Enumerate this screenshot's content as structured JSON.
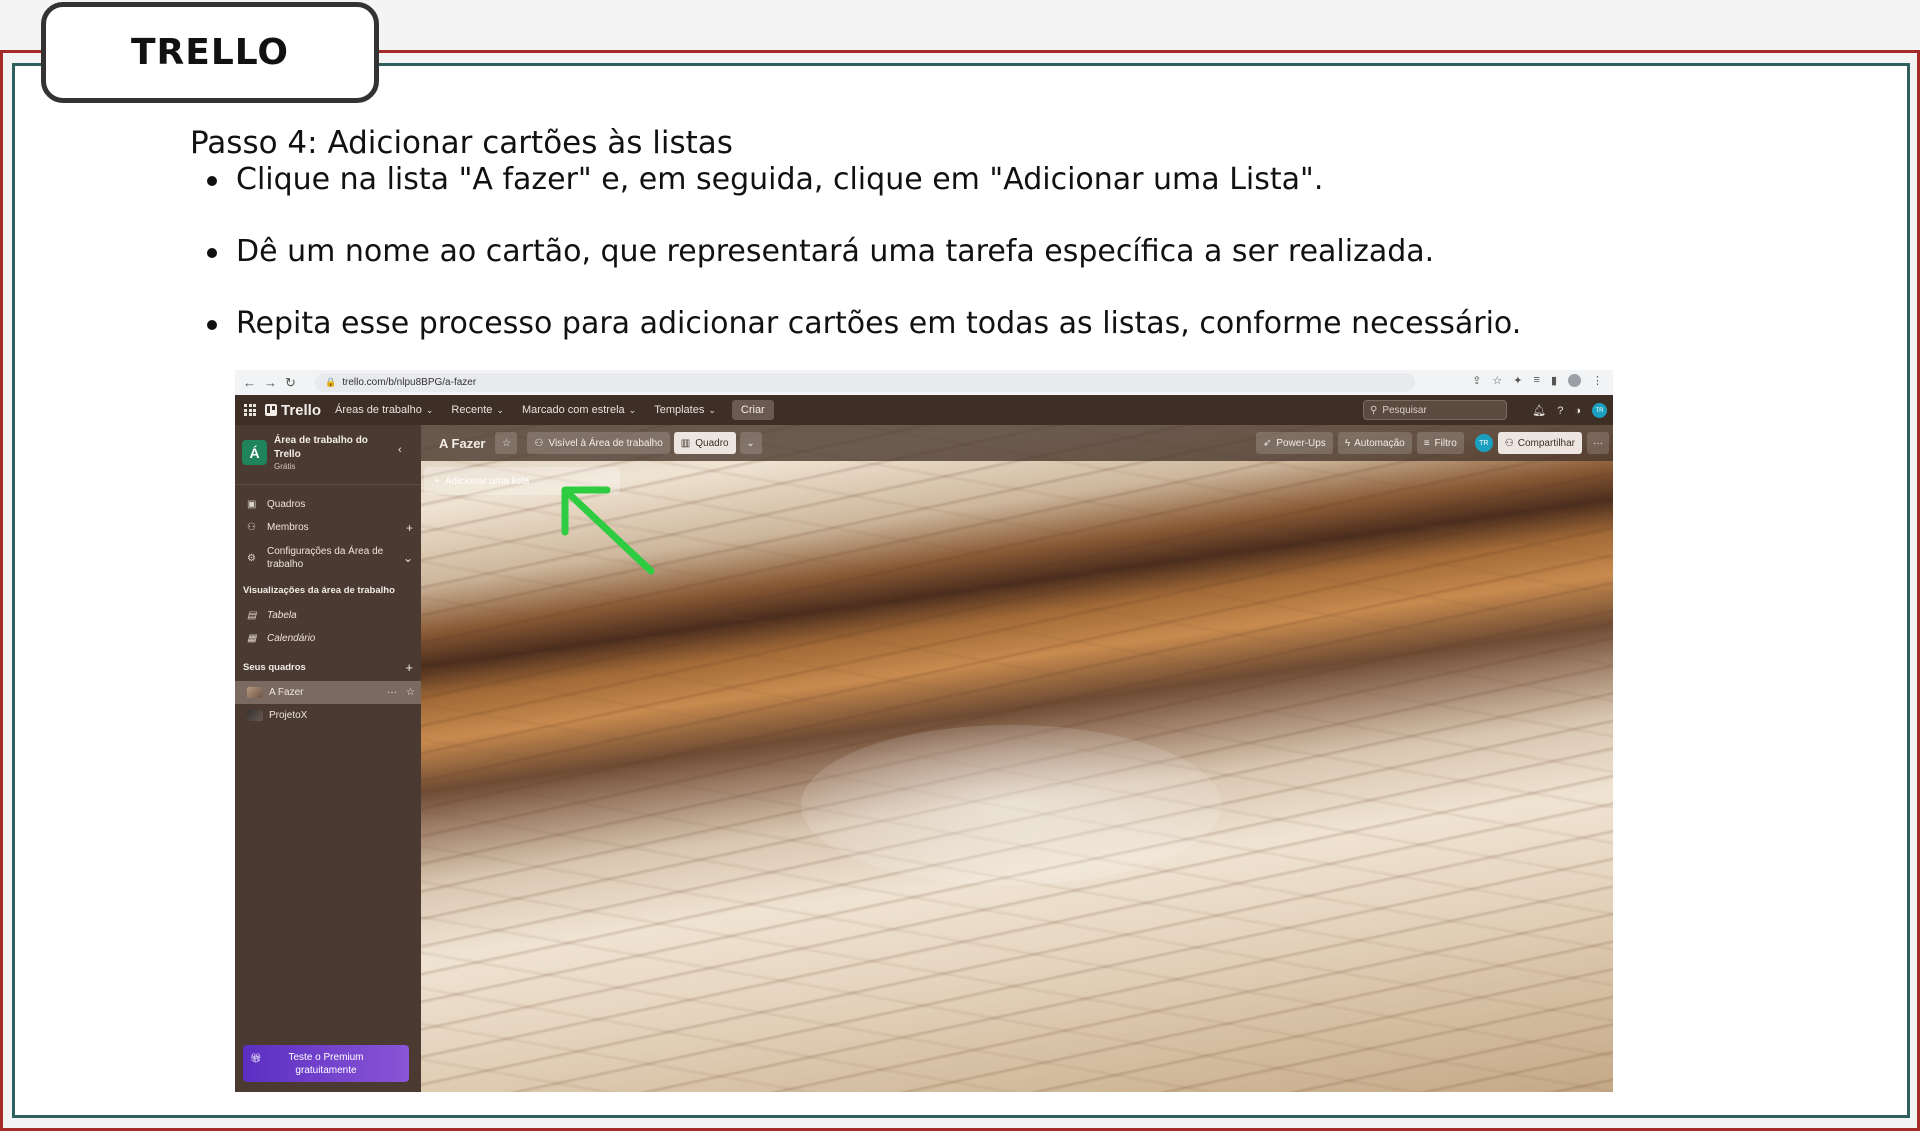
{
  "slide": {
    "tab_title": "TRELLO",
    "step_title": "Passo 4: Adicionar cartões às listas",
    "bullets": [
      "Clique na lista \"A fazer\" e, em seguida, clique em \"Adicionar uma Lista\".",
      "Dê um nome ao cartão, que representará uma tarefa específica a ser realizada.",
      "Repita esse processo para adicionar cartões em todas as listas, conforme necessário."
    ]
  },
  "browser": {
    "url": "trello.com/b/nlpu8BPG/a-fazer"
  },
  "topbar": {
    "logo": "Trello",
    "menu": [
      "Áreas de trabalho",
      "Recente",
      "Marcado com estrela",
      "Templates"
    ],
    "create": "Criar",
    "search_placeholder": "Pesquisar",
    "avatar": "TR"
  },
  "sidebar": {
    "workspace_letter": "Á",
    "workspace_name": "Área de trabalho do Trello",
    "workspace_plan": "Grátis",
    "items": [
      "Quadros",
      "Membros",
      "Configurações da Área de trabalho"
    ],
    "views_title": "Visualizações da área de trabalho",
    "views": [
      "Tabela",
      "Calendário"
    ],
    "boards_title": "Seus quadros",
    "boards": [
      "A Fazer",
      "ProjetoX"
    ],
    "premium": "Teste o Premium gratuitamente"
  },
  "board": {
    "title": "A Fazer",
    "visibility": "Visível à Área de trabalho",
    "view": "Quadro",
    "powerups": "Power-Ups",
    "automation": "Automação",
    "filter": "Filtro",
    "share": "Compartilhar",
    "avatar": "TR",
    "add_list": "Adicionar uma lista"
  },
  "colors": {
    "frame_outer": "#a52a2a",
    "frame_inner": "#2f5f5f",
    "arrow": "#2ecc40",
    "workspace_badge": "#1f845a",
    "premium": "#6a3fcf"
  }
}
